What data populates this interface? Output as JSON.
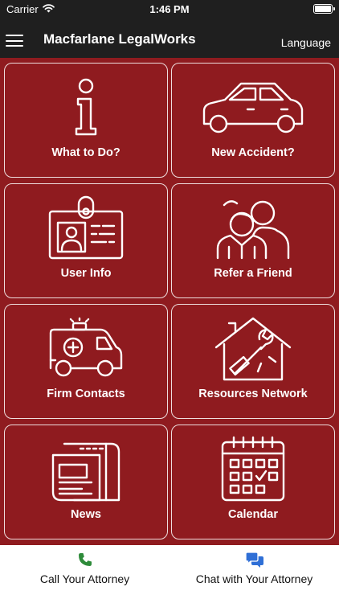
{
  "status_bar": {
    "carrier": "Carrier",
    "time": "1:46 PM"
  },
  "nav": {
    "title": "Macfarlane LegalWorks",
    "language_label": "Language",
    "menu_icon": "hamburger-icon"
  },
  "tiles": [
    {
      "label": "What to Do?",
      "icon": "info-icon"
    },
    {
      "label": "New Accident?",
      "icon": "car-icon"
    },
    {
      "label": "User Info",
      "icon": "id-card-icon"
    },
    {
      "label": "Refer a Friend",
      "icon": "people-icon"
    },
    {
      "label": "Firm Contacts",
      "icon": "ambulance-icon"
    },
    {
      "label": "Resources Network",
      "icon": "house-tools-icon"
    },
    {
      "label": "News",
      "icon": "newspaper-icon"
    },
    {
      "label": "Calendar",
      "icon": "calendar-icon"
    }
  ],
  "bottom_bar": {
    "call_label": "Call Your Attorney",
    "chat_label": "Chat with Your Attorney"
  },
  "colors": {
    "tile_background": "#8f1b1f",
    "nav_background": "#1f1f1f",
    "call_icon": "#2e8b3a",
    "chat_icon": "#2f6fd6"
  }
}
